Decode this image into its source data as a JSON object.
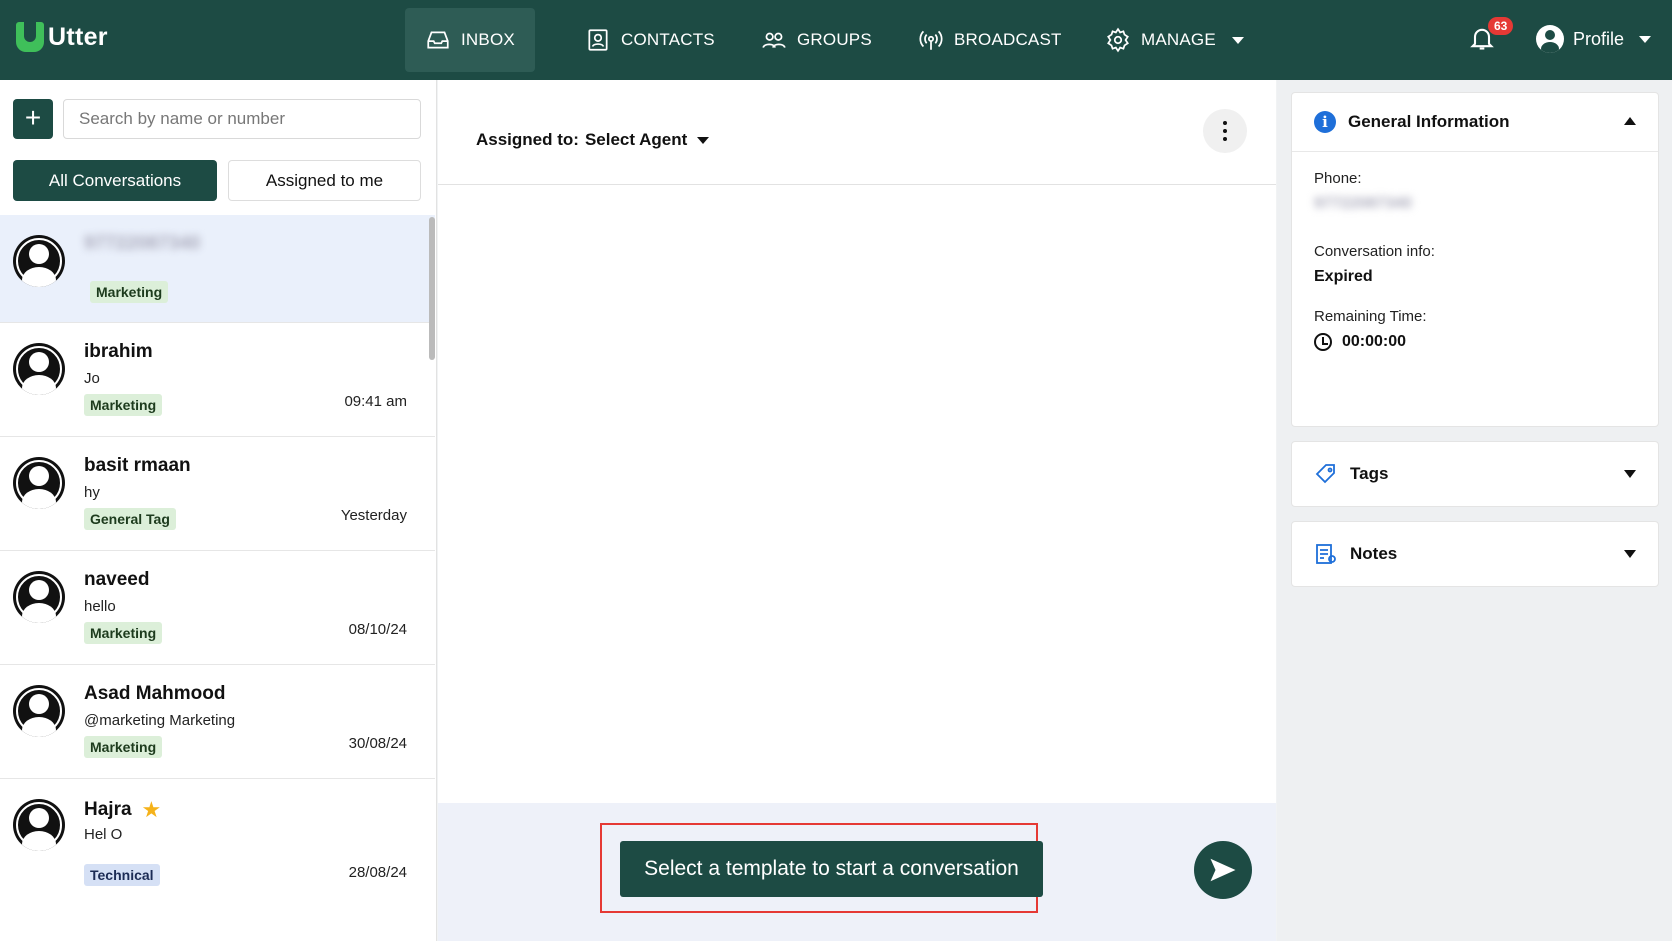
{
  "brand": {
    "name": "Utter"
  },
  "nav": {
    "inbox": "INBOX",
    "contacts": "CONTACTS",
    "groups": "GROUPS",
    "broadcast": "BROADCAST",
    "manage": "MANAGE"
  },
  "notifications": {
    "count": "63"
  },
  "profile": {
    "label": "Profile"
  },
  "sidebar": {
    "add_label": "+",
    "search_placeholder": "Search by name or number",
    "tabs": {
      "all": "All Conversations",
      "mine": "Assigned to me"
    },
    "conversations": [
      {
        "name": "97722087340",
        "message": "",
        "tag": "Marketing",
        "time": ""
      },
      {
        "name": "ibrahim",
        "message": "Jo",
        "tag": "Marketing",
        "time": "09:41 am"
      },
      {
        "name": "basit rmaan",
        "message": "hy",
        "tag": "General Tag",
        "time": "Yesterday"
      },
      {
        "name": "naveed",
        "message": "hello",
        "tag": "Marketing",
        "time": "08/10/24"
      },
      {
        "name": "Asad Mahmood",
        "message": "@marketing Marketing",
        "tag": "Marketing",
        "time": "30/08/24"
      },
      {
        "name": "Hajra",
        "message": "Hel O",
        "tag": "Technical",
        "time": "28/08/24"
      }
    ]
  },
  "chat": {
    "assigned_label": "Assigned to:",
    "agent": "Select Agent",
    "template_button": "Select a template to start a conversation"
  },
  "details": {
    "general_title": "General Information",
    "phone_label": "Phone:",
    "phone_value": "97722087340",
    "conv_info_label": "Conversation info:",
    "conv_info_value": "Expired",
    "remaining_label": "Remaining Time:",
    "remaining_value": "00:00:00",
    "tags_title": "Tags",
    "notes_title": "Notes"
  },
  "colors": {
    "primary": "#1d4b44",
    "accent_green": "#3fbf5a",
    "info_blue": "#1e6fd9",
    "alert_red": "#e53935"
  }
}
